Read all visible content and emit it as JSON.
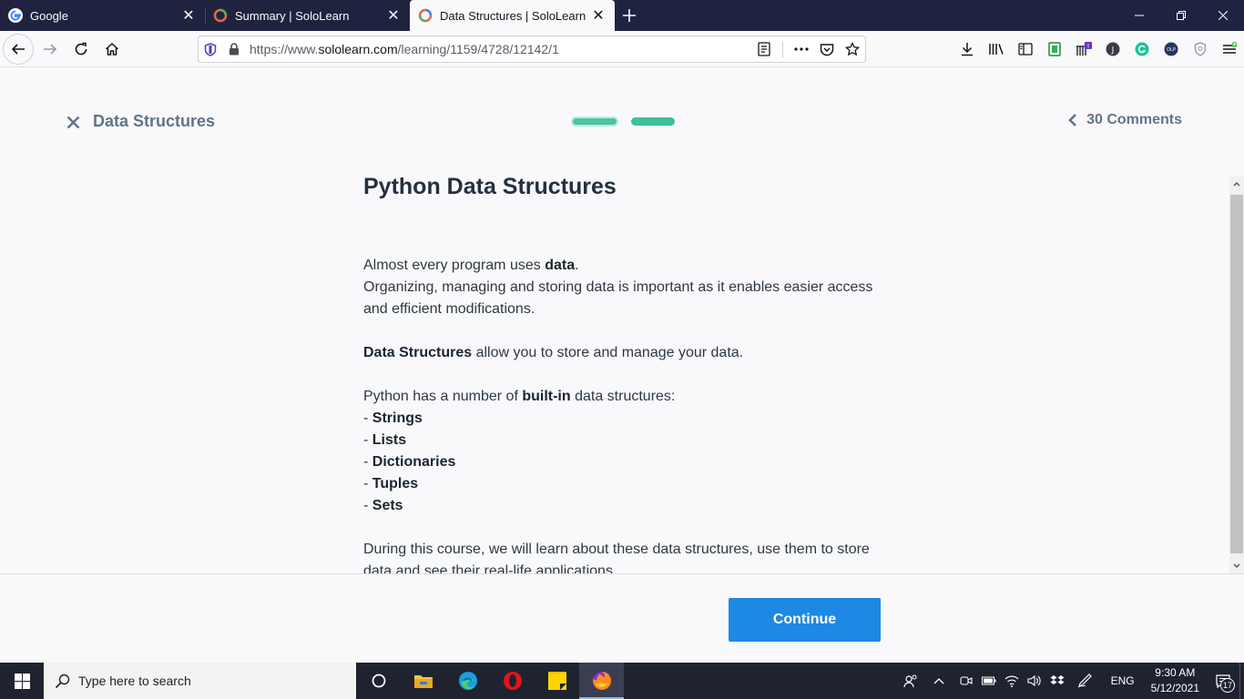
{
  "browser": {
    "tabs": [
      {
        "label": "Google",
        "favicon": "google-g-icon",
        "active": false
      },
      {
        "label": "Summary | SoloLearn",
        "favicon": "sololearn-icon",
        "active": false
      },
      {
        "label": "Data Structures | SoloLearn",
        "favicon": "sololearn-icon",
        "active": true
      }
    ],
    "url": {
      "prefix": "https://www.",
      "domain": "sololearn.com",
      "path": "/learning/1159/4728/12142/1"
    },
    "toolbar_icons": [
      "download-icon",
      "library-icon",
      "sidebar-icon",
      "extension-green-icon",
      "extension-bars-icon",
      "profile-j-icon",
      "grammarly-icon",
      "extension-round-icon",
      "shield-extension-icon",
      "menu-icon"
    ],
    "extension_badge": "!"
  },
  "lesson": {
    "course_title": "Data Structures",
    "progress": {
      "total_steps": 2,
      "current_step": 1
    },
    "comments_label": "30 Comments",
    "heading": "Python Data Structures",
    "intro_normal": "Almost every program uses ",
    "intro_bold": "data",
    "intro_end": ".",
    "line2": "Organizing, managing and storing data is important as it enables easier access and efficient modifications.",
    "ds_bold": "Data Structures",
    "ds_rest": " allow you to store and manage your data.",
    "builtin_pre": "Python has a number of ",
    "builtin_bold": "built-in",
    "builtin_post": " data structures:",
    "list_prefix": "- ",
    "list": [
      "Strings",
      "Lists",
      "Dictionaries",
      "Tuples",
      "Sets"
    ],
    "closing": "During this course, we will learn about these data structures, use them to store data and see their real-life applications.",
    "continue_label": "Continue"
  },
  "taskbar": {
    "search_placeholder": "Type here to search",
    "apps": [
      "cortana-icon",
      "file-explorer-icon",
      "edge-icon",
      "opera-icon",
      "sticky-notes-icon",
      "firefox-icon"
    ],
    "lang": "ENG",
    "time": "9:30 AM",
    "date": "5/12/2021",
    "notification_count": "17"
  },
  "colors": {
    "tabbar": "#202340",
    "accent_green": "#4dc4a4",
    "continue_blue": "#1e88e5",
    "muted_title": "#637488"
  }
}
